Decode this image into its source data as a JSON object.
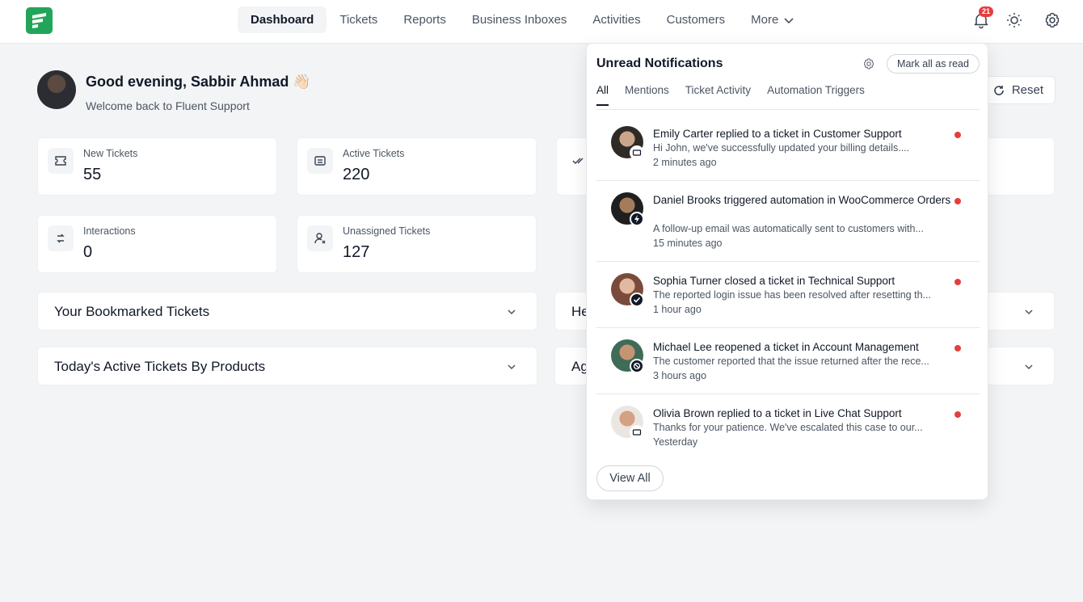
{
  "colors": {
    "brand": "#22a55a",
    "accent_red": "#e53e3e",
    "text_dark": "#111827",
    "text_muted": "#4b5563"
  },
  "nav": {
    "items": [
      {
        "label": "Dashboard",
        "active": true
      },
      {
        "label": "Tickets",
        "active": false
      },
      {
        "label": "Reports",
        "active": false
      },
      {
        "label": "Business Inboxes",
        "active": false
      },
      {
        "label": "Activities",
        "active": false
      },
      {
        "label": "Customers",
        "active": false
      }
    ],
    "more_label": "More",
    "notification_count": "21",
    "icons": [
      "bell-icon",
      "sun-icon",
      "gear-icon"
    ]
  },
  "greeting": {
    "title": "Good evening, Sabbir Ahmad 👋🏻",
    "subtitle": "Welcome back to Fluent Support"
  },
  "reset_label": "Reset",
  "stats": [
    {
      "label": "New Tickets",
      "value": "55",
      "icon": "ticket-icon"
    },
    {
      "label": "Active Tickets",
      "value": "220",
      "icon": "ticket-open-icon"
    },
    {
      "label": "Interactions",
      "value": "0",
      "icon": "interaction-icon"
    },
    {
      "label": "Unassigned Tickets",
      "value": "127",
      "icon": "user-x-icon"
    }
  ],
  "panels": [
    {
      "title": "Your Bookmarked Tickets"
    },
    {
      "title": "Today's Active Tickets By Products"
    },
    {
      "title": "He"
    },
    {
      "title": "Ag"
    }
  ],
  "notifications": {
    "title": "Unread Notifications",
    "mark_all_label": "Mark all as read",
    "tabs": [
      "All",
      "Mentions",
      "Ticket Activity",
      "Automation Triggers"
    ],
    "items": [
      {
        "title": "Emily Carter replied to a ticket in Customer Support",
        "body": "Hi John, we've successfully updated your billing details....",
        "time": "2 minutes ago",
        "badge": "reply-icon"
      },
      {
        "title": "Daniel Brooks triggered automation in WooCommerce Orders",
        "body": "A follow-up email was automatically sent to customers with...",
        "time": "15 minutes ago",
        "badge": "lightning-icon"
      },
      {
        "title": "Sophia Turner closed a ticket in Technical Support",
        "body": "The reported login issue has been resolved after resetting th...",
        "time": "1 hour ago",
        "badge": "check-icon"
      },
      {
        "title": "Michael Lee reopened a ticket in Account Management",
        "body": "The customer reported that the issue returned after the rece...",
        "time": "3 hours ago",
        "badge": "reopen-icon"
      },
      {
        "title": "Olivia Brown replied to a ticket in Live Chat Support",
        "body": "Thanks for your patience. We've escalated this case to our...",
        "time": "Yesterday",
        "badge": "reply-icon"
      }
    ],
    "view_all_label": "View All"
  }
}
